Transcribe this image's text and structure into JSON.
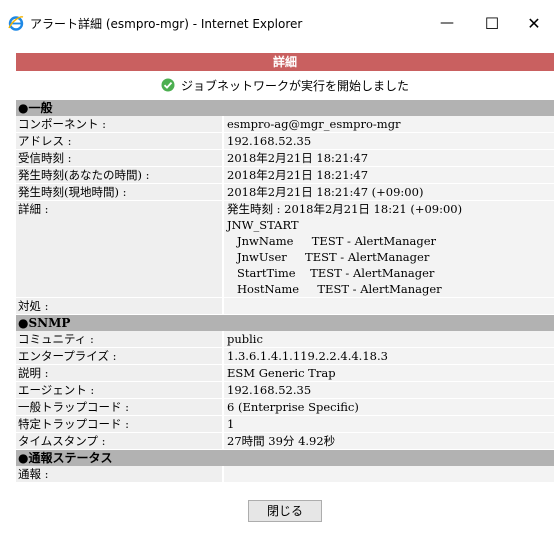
{
  "window": {
    "title": "アラート詳細 (esmpro-mgr) - Internet Explorer",
    "minimize_glyph": "—",
    "maximize_glyph": "☐",
    "close_glyph": "✕"
  },
  "banner": "詳細",
  "notice": "ジョブネットワークが実行を開始しました",
  "sections": {
    "general": {
      "header": "●一般",
      "component_label": "コンポーネント :",
      "component_value": "esmpro-ag@mgr_esmpro-mgr",
      "address_label": "アドレス :",
      "address_value": "192.168.52.35",
      "received_label": "受信時刻 :",
      "received_value": "2018年2月21日 18:21:47",
      "occurred_yours_label": "発生時刻(あなたの時間) :",
      "occurred_yours_value": "2018年2月21日 18:21:47",
      "occurred_local_label": "発生時刻(現地時間) :",
      "occurred_local_value": "2018年2月21日 18:21:47 (+09:00)",
      "detail_label": "詳細 :",
      "detail_lines": [
        "発生時刻 : 2018年2月21日 18:21 (+09:00)",
        "JNW_START",
        "JnwName     TEST - AlertManager",
        "JnwUser     TEST - AlertManager",
        "StartTime    TEST - AlertManager",
        "HostName     TEST - AlertManager"
      ],
      "action_label": "対処 :",
      "action_value": ""
    },
    "snmp": {
      "header": "●SNMP",
      "community_label": "コミュニティ :",
      "community_value": "public",
      "enterprise_label": "エンタープライズ :",
      "enterprise_value": "1.3.6.1.4.1.119.2.2.4.4.18.3",
      "description_label": "説明 :",
      "description_value": "ESM Generic Trap",
      "agent_label": "エージェント :",
      "agent_value": "192.168.52.35",
      "generic_trap_label": "一般トラップコード :",
      "generic_trap_value": "6 (Enterprise Specific)",
      "specific_trap_label": "特定トラップコード :",
      "specific_trap_value": "1",
      "timestamp_label": "タイムスタンプ :",
      "timestamp_value": "27時間 39分 4.92秒"
    },
    "notify": {
      "header": "●通報ステータス",
      "notify_label": "通報 :",
      "notify_value": ""
    }
  },
  "close_button": "閉じる",
  "colors": {
    "banner": "#c96060",
    "section_header": "#b2b2b2",
    "row_bg": "#efefef",
    "check": "#4caf50"
  },
  "icons": {
    "app": "internet-explorer-icon",
    "notice": "check-circle-icon"
  }
}
